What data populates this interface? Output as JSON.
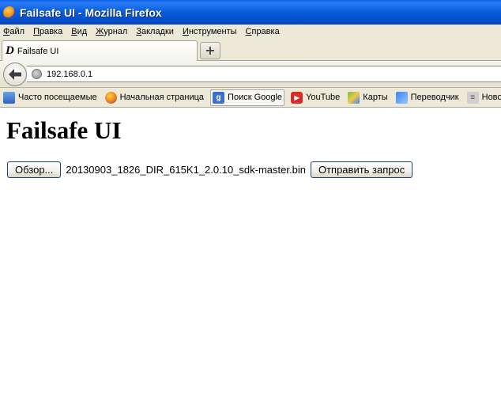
{
  "window": {
    "title": "Failsafe UI - Mozilla Firefox"
  },
  "menubar": {
    "items": [
      {
        "accel": "Ф",
        "rest": "айл"
      },
      {
        "accel": "П",
        "rest": "равка"
      },
      {
        "accel": "В",
        "rest": "ид"
      },
      {
        "accel": "Ж",
        "rest": "урнал"
      },
      {
        "accel": "З",
        "rest": "акладки"
      },
      {
        "accel": "И",
        "rest": "нструменты"
      },
      {
        "accel": "С",
        "rest": "правка"
      }
    ]
  },
  "tabs": [
    {
      "favicon": "D",
      "label": "Failsafe UI"
    }
  ],
  "newtab": {
    "label": "+"
  },
  "navbar": {
    "url": "192.168.0.1"
  },
  "bookmarks": [
    {
      "icon": "often-visited-icon",
      "label": "Часто посещаемые"
    },
    {
      "icon": "firefox-icon",
      "label": "Начальная страница"
    },
    {
      "icon": "google-icon",
      "glyph": "g",
      "label": "Поиск Google"
    },
    {
      "icon": "youtube-icon",
      "glyph": "▶",
      "label": "YouTube"
    },
    {
      "icon": "maps-icon",
      "label": "Карты"
    },
    {
      "icon": "translate-icon",
      "label": "Переводчик"
    },
    {
      "icon": "news-icon",
      "glyph": "≡",
      "label": "Новости"
    }
  ],
  "page": {
    "heading": "Failsafe UI",
    "browse_label": "Обзор...",
    "filename": "20130903_1826_DIR_615K1_2.0.10_sdk-master.bin",
    "submit_label": "Отправить запрос"
  }
}
